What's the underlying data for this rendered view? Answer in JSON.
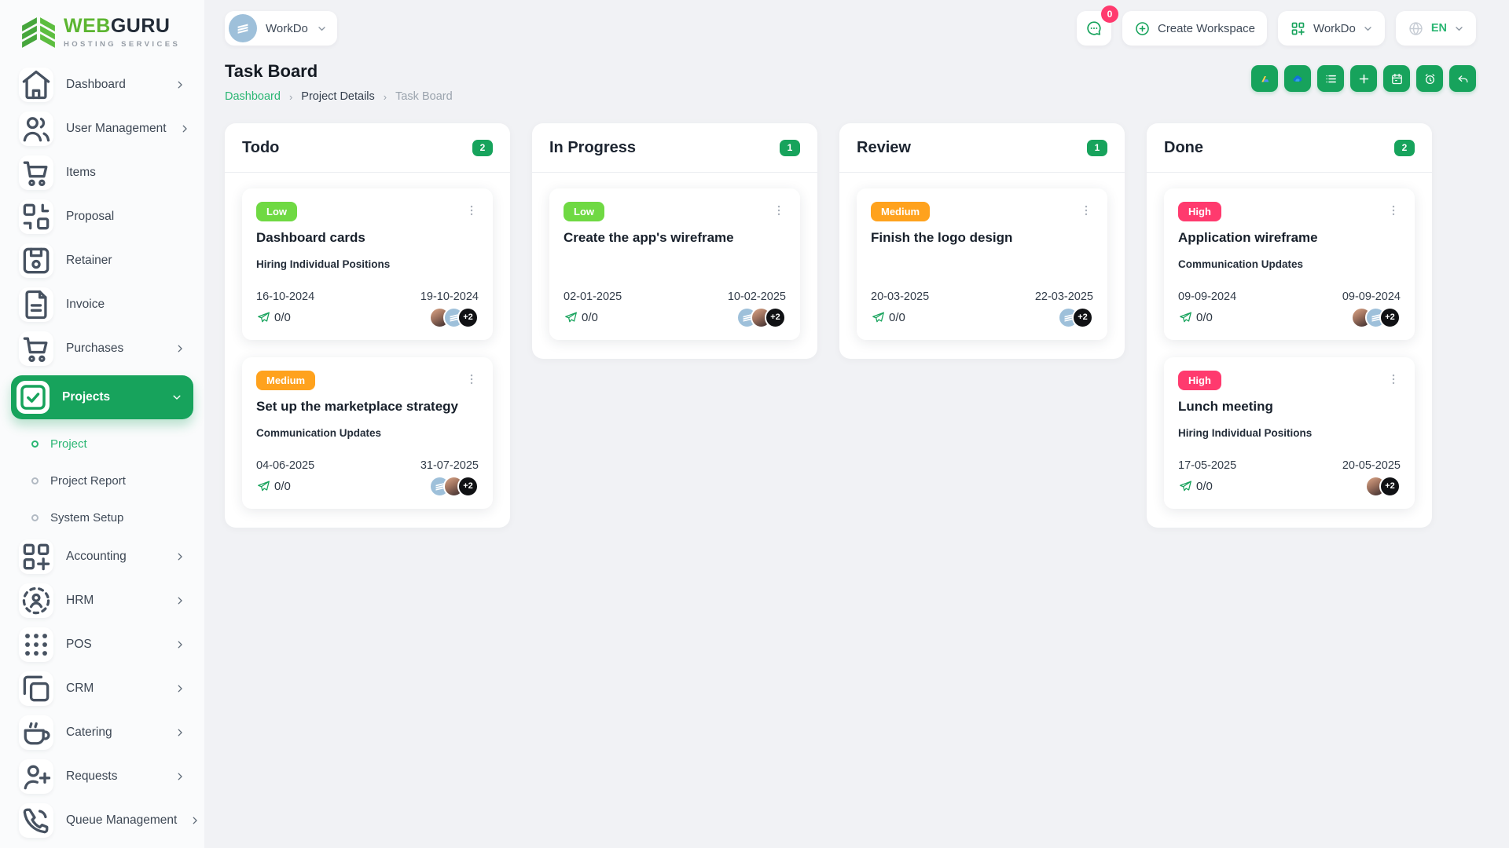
{
  "brand": {
    "name_primary": "WEB",
    "name_secondary": "GURU",
    "tagline": "HOSTING SERVICES"
  },
  "topbar": {
    "workspace": {
      "label": "WorkDo"
    },
    "chat_badge": "0",
    "create_workspace": "Create Workspace",
    "app_switcher": "WorkDo",
    "language": "EN"
  },
  "page": {
    "title": "Task Board",
    "breadcrumb": {
      "home": "Dashboard",
      "section": "Project Details",
      "current": "Task Board"
    }
  },
  "toolbar": [
    {
      "name": "google-drive",
      "icon": "google-drive-icon"
    },
    {
      "name": "onedrive",
      "icon": "onedrive-icon"
    },
    {
      "name": "list-view",
      "icon": "list-icon"
    },
    {
      "name": "add-task",
      "icon": "plus-icon"
    },
    {
      "name": "calendar-view",
      "icon": "calendar-icon"
    },
    {
      "name": "timer",
      "icon": "timer-icon"
    },
    {
      "name": "back",
      "icon": "undo-icon"
    }
  ],
  "sidebar": {
    "items": [
      {
        "label": "Dashboard",
        "icon": "home-icon",
        "chevron": true
      },
      {
        "label": "User Management",
        "icon": "users-icon",
        "chevron": true
      },
      {
        "label": "Items",
        "icon": "cart-icon",
        "chevron": false
      },
      {
        "label": "Proposal",
        "icon": "qr-icon",
        "chevron": false
      },
      {
        "label": "Retainer",
        "icon": "save-icon",
        "chevron": false
      },
      {
        "label": "Invoice",
        "icon": "invoice-icon",
        "chevron": false
      },
      {
        "label": "Purchases",
        "icon": "cart-icon",
        "chevron": true
      },
      {
        "label": "Projects",
        "icon": "check-square-icon",
        "chevron": true,
        "active": true,
        "children": [
          {
            "label": "Project",
            "active": true
          },
          {
            "label": "Project Report"
          },
          {
            "label": "System Setup"
          }
        ]
      },
      {
        "label": "Accounting",
        "icon": "grid-plus-icon",
        "chevron": true
      },
      {
        "label": "HRM",
        "icon": "hrm-icon",
        "chevron": true
      },
      {
        "label": "POS",
        "icon": "pos-icon",
        "chevron": true
      },
      {
        "label": "CRM",
        "icon": "copy-icon",
        "chevron": true
      },
      {
        "label": "Catering",
        "icon": "coffee-icon",
        "chevron": true
      },
      {
        "label": "Requests",
        "icon": "user-plus-icon",
        "chevron": true
      },
      {
        "label": "Queue Management",
        "icon": "phone-icon",
        "chevron": true
      }
    ]
  },
  "board": {
    "columns": [
      {
        "name": "Todo",
        "count": "2",
        "cards": [
          {
            "priority": "Low",
            "priority_color": "#6fd943",
            "title": "Dashboard cards",
            "subtitle": "Hiring Individual Positions",
            "start_date": "16-10-2024",
            "end_date": "19-10-2024",
            "progress": "0/0",
            "more_label": "+2",
            "avatars": [
              "photo",
              "logo"
            ]
          },
          {
            "priority": "Medium",
            "priority_color": "#ffa21d",
            "title": "Set up the marketplace strategy",
            "subtitle": "Communication Updates",
            "start_date": "04-06-2025",
            "end_date": "31-07-2025",
            "progress": "0/0",
            "more_label": "+2",
            "avatars": [
              "logo",
              "photo"
            ]
          }
        ]
      },
      {
        "name": "In Progress",
        "count": "1",
        "cards": [
          {
            "priority": "Low",
            "priority_color": "#6fd943",
            "title": "Create the app's wireframe",
            "subtitle": "",
            "start_date": "02-01-2025",
            "end_date": "10-02-2025",
            "progress": "0/0",
            "more_label": "+2",
            "avatars": [
              "logo",
              "photo"
            ]
          }
        ]
      },
      {
        "name": "Review",
        "count": "1",
        "cards": [
          {
            "priority": "Medium",
            "priority_color": "#ffa21d",
            "title": "Finish the logo design",
            "subtitle": "",
            "start_date": "20-03-2025",
            "end_date": "22-03-2025",
            "progress": "0/0",
            "more_label": "+2",
            "avatars": [
              "logo"
            ]
          }
        ]
      },
      {
        "name": "Done",
        "count": "2",
        "cards": [
          {
            "priority": "High",
            "priority_color": "#ff3a6e",
            "title": "Application wireframe",
            "subtitle": "Communication Updates",
            "start_date": "09-09-2024",
            "end_date": "09-09-2024",
            "progress": "0/0",
            "more_label": "+2",
            "avatars": [
              "photo",
              "logo"
            ]
          },
          {
            "priority": "High",
            "priority_color": "#ff3a6e",
            "title": "Lunch meeting",
            "subtitle": "Hiring Individual Positions",
            "start_date": "17-05-2025",
            "end_date": "20-05-2025",
            "progress": "0/0",
            "more_label": "+2",
            "avatars": [
              "photo"
            ]
          }
        ]
      }
    ]
  },
  "colors": {
    "accent": "#17a35c",
    "link_green": "#2bb673",
    "low": "#6fd943",
    "medium": "#ffa21d",
    "high": "#ff3a6e",
    "badge_pink": "#ff3a6e"
  }
}
